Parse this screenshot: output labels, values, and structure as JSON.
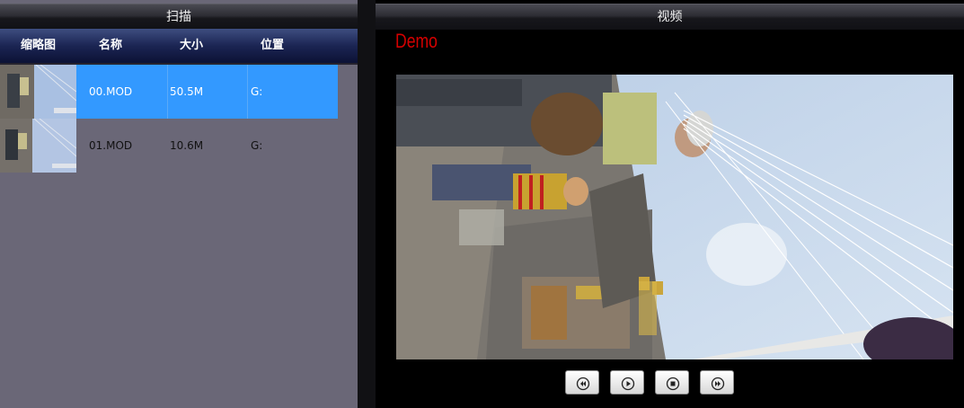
{
  "left_panel": {
    "title": "扫描",
    "columns": {
      "thumbnail": "缩略图",
      "name": "名称",
      "size": "大小",
      "location": "位置"
    },
    "files": [
      {
        "name": "00.MOD",
        "size": "50.5M",
        "location": "G:",
        "selected": true
      },
      {
        "name": "01.MOD",
        "size": "10.6M",
        "location": "G:",
        "selected": false
      }
    ]
  },
  "right_panel": {
    "title": "视频",
    "watermark": "Demo",
    "controls": [
      "rewind-icon",
      "play-icon",
      "stop-icon",
      "fast-forward-icon"
    ]
  },
  "colors": {
    "selected_row": "#3399ff",
    "list_background": "#6a6777",
    "watermark": "#d40000"
  }
}
